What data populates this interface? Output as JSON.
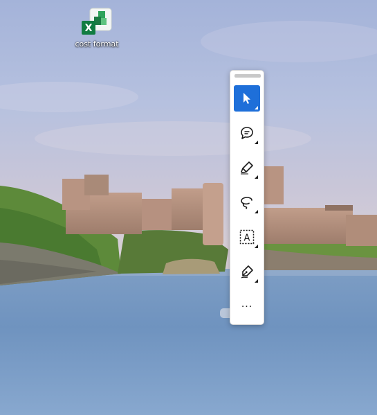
{
  "desktop": {
    "icons": [
      {
        "label": "cost format",
        "icon": "excel-file-icon"
      }
    ]
  },
  "ink_toolbar": {
    "tools": [
      {
        "name": "select",
        "icon": "cursor-arrow-icon",
        "active": true
      },
      {
        "name": "comment",
        "icon": "speech-bubble-icon",
        "active": false
      },
      {
        "name": "highlight",
        "icon": "highlighter-icon",
        "active": false
      },
      {
        "name": "lasso",
        "icon": "lasso-icon",
        "active": false
      },
      {
        "name": "text",
        "icon": "text-box-icon",
        "active": false
      },
      {
        "name": "pen",
        "icon": "pen-icon",
        "active": false
      }
    ],
    "more_label": "...",
    "accent_color": "#1e6fd9"
  }
}
